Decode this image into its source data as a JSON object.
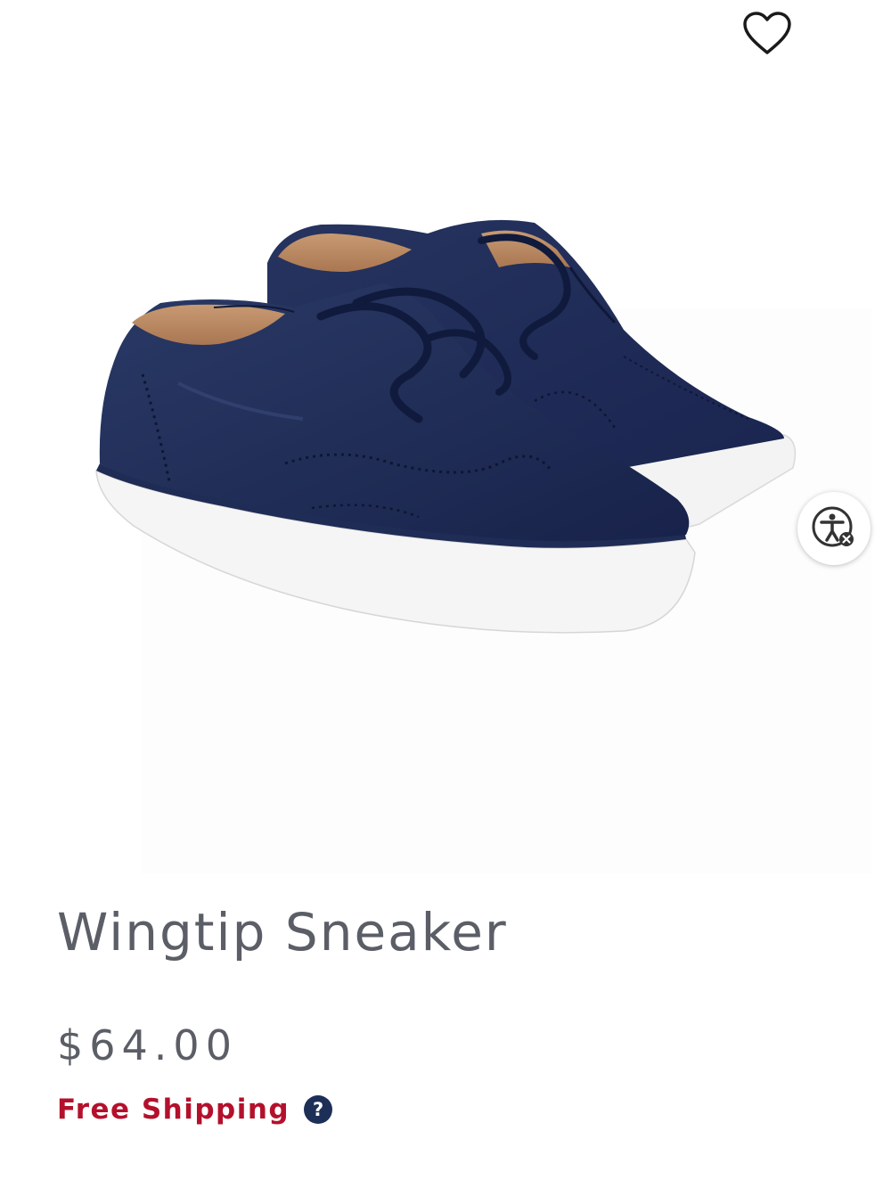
{
  "product": {
    "title": "Wingtip Sneaker",
    "price": "$64.00",
    "shipping_label": "Free Shipping",
    "help_glyph": "?"
  },
  "icons": {
    "favorite": "heart-outline-icon",
    "accessibility": "accessibility-person-icon",
    "help": "question-mark-icon"
  },
  "colors": {
    "title": "#5b5e66",
    "shipping": "#b4102c",
    "help_badge": "#1d2f57",
    "shoe_navy": "#1f2c55",
    "sole_white": "#f4f4f4"
  }
}
